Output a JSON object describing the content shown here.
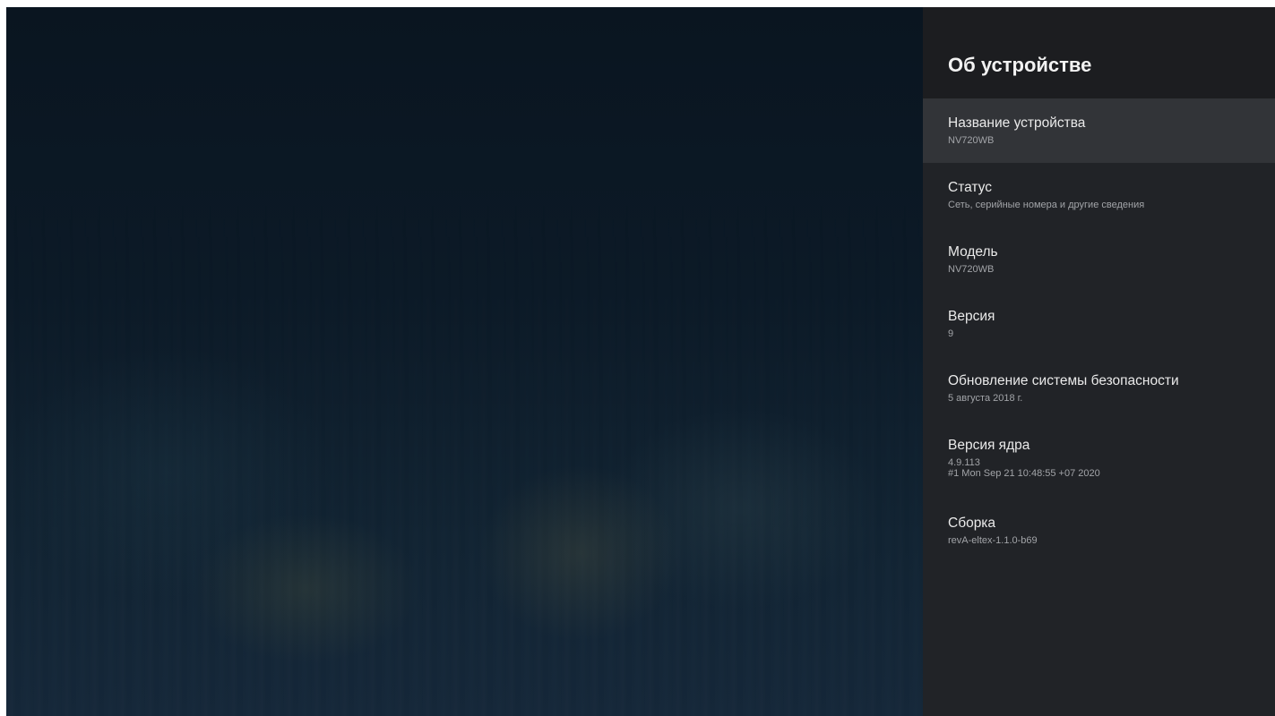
{
  "panel": {
    "title": "Об устройстве",
    "items": [
      {
        "title": "Название устройства",
        "subtitle": "NV720WB"
      },
      {
        "title": "Статус",
        "subtitle": "Сеть, серийные номера и другие сведения"
      },
      {
        "title": "Модель",
        "subtitle": "NV720WB"
      },
      {
        "title": "Версия",
        "subtitle": "9"
      },
      {
        "title": "Обновление системы безопасности",
        "subtitle": "5 августа 2018 г."
      },
      {
        "title": "Версия ядра",
        "subtitle": "4.9.113\n#1 Mon Sep 21 10:48:55 +07 2020"
      },
      {
        "title": "Сборка",
        "subtitle": "revA-eltex-1.1.0-b69"
      }
    ]
  },
  "colors": {
    "panel_bg": "#212327",
    "header_bg": "#1c1d20",
    "focused_item_bg": "#323438",
    "title_text": "#eaeaea",
    "subtitle_text": "#a2a4a8"
  }
}
